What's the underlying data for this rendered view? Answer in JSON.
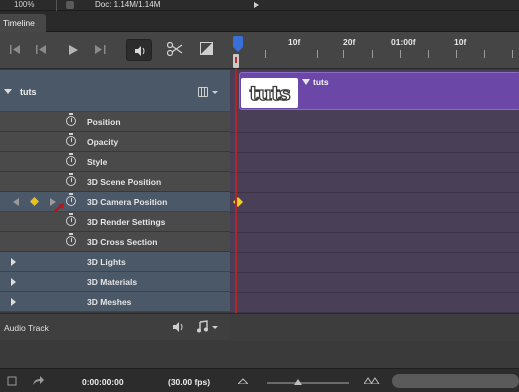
{
  "topbar": {
    "zoom": "100%",
    "doc": "Doc: 1.14M/1.14M"
  },
  "panel": {
    "tab_label": "Timeline"
  },
  "ruler": {
    "labels": [
      "10f",
      "20f",
      "01:00f",
      "10f"
    ]
  },
  "track": {
    "name": "tuts",
    "clip_name": "tuts",
    "clip_thumb_text": "tuts",
    "properties": [
      {
        "label": "Position"
      },
      {
        "label": "Opacity"
      },
      {
        "label": "Style"
      },
      {
        "label": "3D Scene Position"
      },
      {
        "label": "3D Camera Position",
        "highlighted": true,
        "keyframe": true
      },
      {
        "label": "3D Render Settings"
      },
      {
        "label": "3D Cross Section"
      }
    ],
    "groups": [
      {
        "label": "3D Lights"
      },
      {
        "label": "3D Materials"
      },
      {
        "label": "3D Meshes"
      }
    ]
  },
  "audio": {
    "label": "Audio Track"
  },
  "footer": {
    "timecode": "0:00:00:00",
    "fps": "(30.00 fps)"
  },
  "colors": {
    "clip": "#6b48a8",
    "playhead": "#3b6fd8",
    "current_time_line": "#b32525",
    "keyframe": "#e8c21a"
  }
}
